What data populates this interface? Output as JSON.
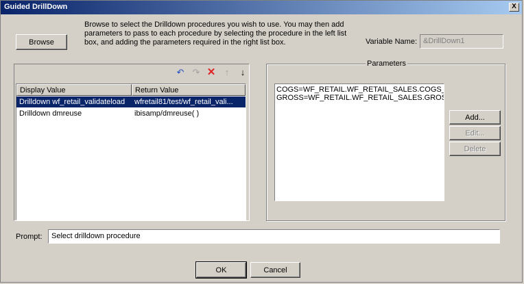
{
  "window": {
    "title": "Guided DrillDown",
    "close_symbol": "X"
  },
  "browse": {
    "label": "Browse",
    "description": "Browse to select the Drilldown procedures you wish to use. You may then add parameters to pass to each procedure by selecting the procedure in the left list box, and adding the parameters required in the right list box."
  },
  "variable": {
    "label": "Variable Name:",
    "value": "&DrillDown1"
  },
  "toolbar": {
    "undo": "↶",
    "redo": "↷",
    "delete": "✕",
    "up": "↑",
    "down": "↓"
  },
  "table": {
    "columns": [
      "Display Value",
      "Return Value"
    ],
    "rows": [
      {
        "display": "Drilldown wf_retail_validateload",
        "return": "wfretail81/test/wf_retail_vali..."
      },
      {
        "display": "Drilldown dmreuse",
        "return": "ibisamp/dmreuse( )"
      }
    ]
  },
  "parameters": {
    "title": "Parameters",
    "items": [
      "COGS=WF_RETAIL.WF_RETAIL_SALES.COGS_US",
      "GROSS=WF_RETAIL.WF_RETAIL_SALES.GROSS_F"
    ],
    "add": "Add...",
    "edit": "Edit...",
    "delete": "Delete"
  },
  "prompt": {
    "label": "Prompt:",
    "value": "Select drilldown procedure"
  },
  "footer": {
    "ok": "OK",
    "cancel": "Cancel"
  }
}
